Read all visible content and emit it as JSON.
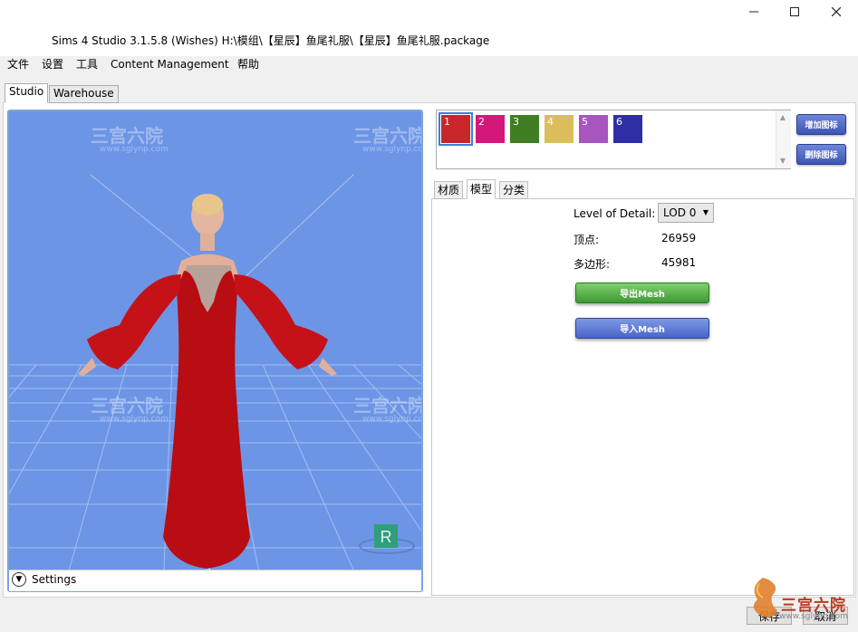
{
  "window": {
    "title": "Sims 4 Studio 3.1.5.8 (Wishes)  H:\\模组\\【星辰】鱼尾礼服\\【星辰】鱼尾礼服.package",
    "minimize_icon": "minimize-icon",
    "maximize_icon": "maximize-icon",
    "close_icon": "close-icon"
  },
  "menu": {
    "items": [
      "文件",
      "设置",
      "工具",
      "Content Management",
      "帮助"
    ]
  },
  "top_tabs": [
    "Studio",
    "Warehouse"
  ],
  "viewport": {
    "settings_label": "Settings",
    "badge_letter": "R",
    "background_color": "#6d95e6"
  },
  "swatches": [
    {
      "label": "1",
      "color": "#c8262a"
    },
    {
      "label": "2",
      "color": "#d4177a"
    },
    {
      "label": "3",
      "color": "#3f7e22"
    },
    {
      "label": "4",
      "color": "#dcbd5c"
    },
    {
      "label": "5",
      "color": "#a855c0"
    },
    {
      "label": "6",
      "color": "#2e2fa4"
    }
  ],
  "side_buttons": {
    "add_icon": "增加图标",
    "remove_icon": "删除图标"
  },
  "sub_tabs": [
    "材质",
    "模型",
    "分类"
  ],
  "model_panel": {
    "lod_label": "Level of Detail:",
    "lod_value": "LOD 0",
    "vertices_label": "顶点:",
    "vertices_value": "26959",
    "polygons_label": "多边形:",
    "polygons_value": "45981",
    "export_button": "导出Mesh",
    "import_button": "导入Mesh"
  },
  "footer": {
    "save_button": "保存",
    "cancel_button": "取消"
  },
  "watermark": {
    "logo_text": "三宫六院",
    "logo_url": "www.sglynp.com"
  }
}
